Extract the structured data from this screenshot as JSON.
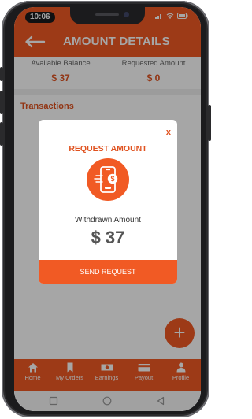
{
  "status_bar": {
    "time": "10:06"
  },
  "app_bar": {
    "title": "AMOUNT DETAILS"
  },
  "balances": {
    "available": {
      "label": "Available Balance",
      "value": "$ 37"
    },
    "requested": {
      "label": "Requested Amount",
      "value": "$ 0"
    }
  },
  "section": {
    "title": "Transactions"
  },
  "fab": {
    "label": "+"
  },
  "modal": {
    "close_label": "x",
    "title": "REQUEST AMOUNT",
    "amount_label": "Withdrawn Amount",
    "amount_value": "$ 37",
    "button_label": "SEND REQUEST"
  },
  "bottom_nav": {
    "items": [
      {
        "label": "Home",
        "icon": "home-icon"
      },
      {
        "label": "My Orders",
        "icon": "bookmark-icon"
      },
      {
        "label": "Earnings",
        "icon": "cash-icon"
      },
      {
        "label": "Payout",
        "icon": "card-icon"
      },
      {
        "label": "Profile",
        "icon": "person-icon"
      }
    ]
  },
  "colors": {
    "accent": "#f15a24",
    "accent_text": "#e0521f"
  }
}
